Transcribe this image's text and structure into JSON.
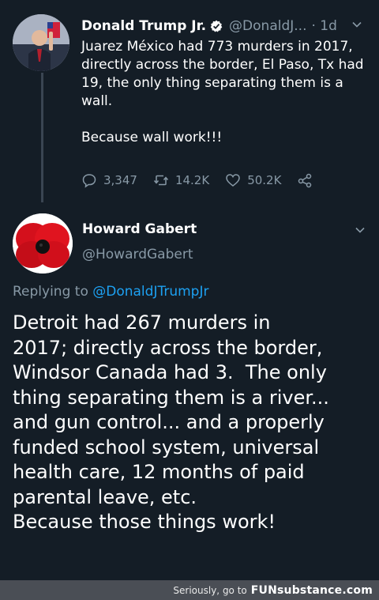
{
  "tweet_original": {
    "display_name": "Donald Trump Jr.",
    "handle": "@DonaldJ...",
    "time": "· 1d",
    "text": "Juarez México had 773 murders in 2017, directly across the border, El Paso, Tx had 19, the only thing separating them is a wall.",
    "text2": "Because wall work!!!",
    "reply_count": "3,347",
    "retweet_count": "14.2K",
    "like_count": "50.2K"
  },
  "tweet_reply": {
    "display_name": "Howard Gabert",
    "handle": "@HowardGabert",
    "replying_prefix": "Replying to ",
    "replying_to": "@DonaldJTrumpJr",
    "lines": [
      "Detroit had 267 murders in",
      "2017; directly across the border,",
      "Windsor Canada had 3.  The only",
      "thing separating them is a river...",
      "and gun control... and a properly",
      "funded school system, universal",
      "health care, 12 months of paid",
      "parental leave, etc.",
      "Because those things work!"
    ]
  },
  "footer": {
    "text": "Seriously, go to",
    "brand": "FUNsubstance.com"
  },
  "colors": {
    "background": "#141d26",
    "secondary_text": "#8899a6",
    "link": "#1da1f2",
    "verified": "#ffffff",
    "footer_bg": "#4a4e55"
  },
  "icons": {
    "reply": "reply-icon",
    "retweet": "retweet-icon",
    "like": "heart-icon",
    "share": "share-icon",
    "more": "chevron-down-icon",
    "verified": "verified-badge-icon"
  }
}
